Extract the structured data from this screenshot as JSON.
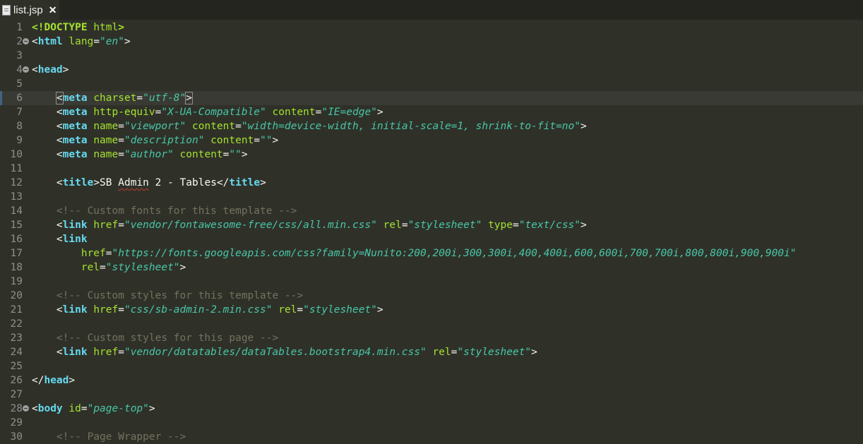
{
  "tab": {
    "title": "list.jsp",
    "close_glyph": "✕",
    "icon": "file-icon"
  },
  "editor": {
    "current_line": 6,
    "lines": [
      {
        "n": "1",
        "fold": false,
        "tokens": [
          [
            "doctype",
            "<!DOCTYPE"
          ],
          [
            "txt",
            " "
          ],
          [
            "atn",
            "html"
          ],
          [
            "doctype",
            ">"
          ]
        ]
      },
      {
        "n": "2",
        "fold": true,
        "tokens": [
          [
            "pun",
            "<"
          ],
          [
            "kw",
            "html"
          ],
          [
            "txt",
            " "
          ],
          [
            "atn",
            "lang"
          ],
          [
            "pun",
            "="
          ],
          [
            "str",
            "\"en\""
          ],
          [
            "pun",
            ">"
          ]
        ]
      },
      {
        "n": "3",
        "fold": false,
        "tokens": []
      },
      {
        "n": "4",
        "fold": true,
        "tokens": [
          [
            "pun",
            "<"
          ],
          [
            "kw",
            "head"
          ],
          [
            "pun",
            ">"
          ]
        ]
      },
      {
        "n": "5",
        "fold": false,
        "tokens": []
      },
      {
        "n": "6",
        "fold": false,
        "tokens": [
          [
            "txt",
            "    "
          ],
          [
            "pun caret-box",
            "<"
          ],
          [
            "kw",
            "meta"
          ],
          [
            "txt",
            " "
          ],
          [
            "atn",
            "charset"
          ],
          [
            "pun",
            "="
          ],
          [
            "str",
            "\"utf-8\""
          ],
          [
            "pun caret-box",
            ">"
          ]
        ]
      },
      {
        "n": "7",
        "fold": false,
        "tokens": [
          [
            "txt",
            "    "
          ],
          [
            "pun",
            "<"
          ],
          [
            "kw",
            "meta"
          ],
          [
            "txt",
            " "
          ],
          [
            "atn",
            "http-equiv"
          ],
          [
            "pun",
            "="
          ],
          [
            "str",
            "\"X-UA-Compatible\""
          ],
          [
            "txt",
            " "
          ],
          [
            "atn",
            "content"
          ],
          [
            "pun",
            "="
          ],
          [
            "str",
            "\"IE=edge\""
          ],
          [
            "pun",
            ">"
          ]
        ]
      },
      {
        "n": "8",
        "fold": false,
        "tokens": [
          [
            "txt",
            "    "
          ],
          [
            "pun",
            "<"
          ],
          [
            "kw",
            "meta"
          ],
          [
            "txt",
            " "
          ],
          [
            "atn",
            "name"
          ],
          [
            "pun",
            "="
          ],
          [
            "str",
            "\"viewport\""
          ],
          [
            "txt",
            " "
          ],
          [
            "atn",
            "content"
          ],
          [
            "pun",
            "="
          ],
          [
            "str",
            "\"width=device-width, initial-scale=1, shrink-to-fit=no\""
          ],
          [
            "pun",
            ">"
          ]
        ]
      },
      {
        "n": "9",
        "fold": false,
        "tokens": [
          [
            "txt",
            "    "
          ],
          [
            "pun",
            "<"
          ],
          [
            "kw",
            "meta"
          ],
          [
            "txt",
            " "
          ],
          [
            "atn",
            "name"
          ],
          [
            "pun",
            "="
          ],
          [
            "str",
            "\"description\""
          ],
          [
            "txt",
            " "
          ],
          [
            "atn",
            "content"
          ],
          [
            "pun",
            "="
          ],
          [
            "str",
            "\"\""
          ],
          [
            "pun",
            ">"
          ]
        ]
      },
      {
        "n": "10",
        "fold": false,
        "tokens": [
          [
            "txt",
            "    "
          ],
          [
            "pun",
            "<"
          ],
          [
            "kw",
            "meta"
          ],
          [
            "txt",
            " "
          ],
          [
            "atn",
            "name"
          ],
          [
            "pun",
            "="
          ],
          [
            "str",
            "\"author\""
          ],
          [
            "txt",
            " "
          ],
          [
            "atn",
            "content"
          ],
          [
            "pun",
            "="
          ],
          [
            "str",
            "\"\""
          ],
          [
            "pun",
            ">"
          ]
        ]
      },
      {
        "n": "11",
        "fold": false,
        "tokens": []
      },
      {
        "n": "12",
        "fold": false,
        "tokens": [
          [
            "txt",
            "    "
          ],
          [
            "pun",
            "<"
          ],
          [
            "kw",
            "title"
          ],
          [
            "pun",
            ">"
          ],
          [
            "txt",
            "SB "
          ],
          [
            "txt squig",
            "Admin"
          ],
          [
            "txt",
            " 2 - Tables"
          ],
          [
            "pun",
            "</"
          ],
          [
            "kw",
            "title"
          ],
          [
            "pun",
            ">"
          ]
        ]
      },
      {
        "n": "13",
        "fold": false,
        "tokens": []
      },
      {
        "n": "14",
        "fold": false,
        "tokens": [
          [
            "txt",
            "    "
          ],
          [
            "cmt",
            "<!-- Custom fonts for this template -->"
          ]
        ]
      },
      {
        "n": "15",
        "fold": false,
        "tokens": [
          [
            "txt",
            "    "
          ],
          [
            "pun",
            "<"
          ],
          [
            "kw",
            "link"
          ],
          [
            "txt",
            " "
          ],
          [
            "atn",
            "href"
          ],
          [
            "pun",
            "="
          ],
          [
            "str",
            "\"vendor/fontawesome-free/css/all.min.css\""
          ],
          [
            "txt",
            " "
          ],
          [
            "atn",
            "rel"
          ],
          [
            "pun",
            "="
          ],
          [
            "str",
            "\"stylesheet\""
          ],
          [
            "txt",
            " "
          ],
          [
            "atn",
            "type"
          ],
          [
            "pun",
            "="
          ],
          [
            "str",
            "\"text/css\""
          ],
          [
            "pun",
            ">"
          ]
        ]
      },
      {
        "n": "16",
        "fold": false,
        "tokens": [
          [
            "txt",
            "    "
          ],
          [
            "pun",
            "<"
          ],
          [
            "kw",
            "link"
          ]
        ]
      },
      {
        "n": "17",
        "fold": false,
        "tokens": [
          [
            "txt",
            "        "
          ],
          [
            "atn",
            "href"
          ],
          [
            "pun",
            "="
          ],
          [
            "str",
            "\"https://fonts.googleapis.com/css?family=Nunito:200,200i,300,300i,400,400i,600,600i,700,700i,800,800i,900,900i\""
          ]
        ]
      },
      {
        "n": "18",
        "fold": false,
        "tokens": [
          [
            "txt",
            "        "
          ],
          [
            "atn",
            "rel"
          ],
          [
            "pun",
            "="
          ],
          [
            "str",
            "\"stylesheet\""
          ],
          [
            "pun",
            ">"
          ]
        ]
      },
      {
        "n": "19",
        "fold": false,
        "tokens": []
      },
      {
        "n": "20",
        "fold": false,
        "tokens": [
          [
            "txt",
            "    "
          ],
          [
            "cmt",
            "<!-- Custom styles for this template -->"
          ]
        ]
      },
      {
        "n": "21",
        "fold": false,
        "tokens": [
          [
            "txt",
            "    "
          ],
          [
            "pun",
            "<"
          ],
          [
            "kw",
            "link"
          ],
          [
            "txt",
            " "
          ],
          [
            "atn",
            "href"
          ],
          [
            "pun",
            "="
          ],
          [
            "str",
            "\"css/sb-admin-2.min.css\""
          ],
          [
            "txt",
            " "
          ],
          [
            "atn",
            "rel"
          ],
          [
            "pun",
            "="
          ],
          [
            "str",
            "\"stylesheet\""
          ],
          [
            "pun",
            ">"
          ]
        ]
      },
      {
        "n": "22",
        "fold": false,
        "tokens": []
      },
      {
        "n": "23",
        "fold": false,
        "tokens": [
          [
            "txt",
            "    "
          ],
          [
            "cmt",
            "<!-- Custom styles for this page -->"
          ]
        ]
      },
      {
        "n": "24",
        "fold": false,
        "tokens": [
          [
            "txt",
            "    "
          ],
          [
            "pun",
            "<"
          ],
          [
            "kw",
            "link"
          ],
          [
            "txt",
            " "
          ],
          [
            "atn",
            "href"
          ],
          [
            "pun",
            "="
          ],
          [
            "str",
            "\"vendor/datatables/dataTables.bootstrap4.min.css\""
          ],
          [
            "txt",
            " "
          ],
          [
            "atn",
            "rel"
          ],
          [
            "pun",
            "="
          ],
          [
            "str",
            "\"stylesheet\""
          ],
          [
            "pun",
            ">"
          ]
        ]
      },
      {
        "n": "25",
        "fold": false,
        "tokens": []
      },
      {
        "n": "26",
        "fold": false,
        "tokens": [
          [
            "pun",
            "</"
          ],
          [
            "kw",
            "head"
          ],
          [
            "pun",
            ">"
          ]
        ]
      },
      {
        "n": "27",
        "fold": false,
        "tokens": []
      },
      {
        "n": "28",
        "fold": true,
        "tokens": [
          [
            "pun",
            "<"
          ],
          [
            "kw",
            "body"
          ],
          [
            "txt",
            " "
          ],
          [
            "atn",
            "id"
          ],
          [
            "pun",
            "="
          ],
          [
            "str",
            "\"page-top\""
          ],
          [
            "pun",
            ">"
          ]
        ]
      },
      {
        "n": "29",
        "fold": false,
        "tokens": []
      },
      {
        "n": "30",
        "fold": false,
        "tokens": [
          [
            "txt",
            "    "
          ],
          [
            "cmt",
            "<!-- Page Wrapper -->"
          ]
        ]
      }
    ]
  },
  "colors": {
    "background": "#2f3129",
    "keyword": "#66d9ef",
    "attribute": "#a6e22e",
    "string": "#49c6a8",
    "comment": "#75715e",
    "text": "#f8f8f2"
  }
}
